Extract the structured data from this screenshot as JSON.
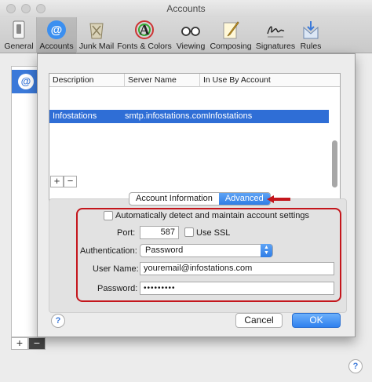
{
  "window": {
    "title": "Accounts"
  },
  "toolbar": {
    "items": [
      {
        "label": "General",
        "icon": "general-switch-icon"
      },
      {
        "label": "Accounts",
        "icon": "at-sign-icon",
        "selected": true
      },
      {
        "label": "Junk Mail",
        "icon": "junk-trash-icon"
      },
      {
        "label": "Fonts & Colors",
        "icon": "fonts-colors-icon"
      },
      {
        "label": "Viewing",
        "icon": "glasses-icon"
      },
      {
        "label": "Composing",
        "icon": "pencil-icon"
      },
      {
        "label": "Signatures",
        "icon": "signature-icon"
      },
      {
        "label": "Rules",
        "icon": "rules-icon"
      }
    ]
  },
  "sidebar": {
    "selected_icon_char": "@",
    "add_label": "+",
    "remove_label": "−"
  },
  "sheet": {
    "table": {
      "columns": [
        "Description",
        "Server Name",
        "In Use By Account"
      ],
      "rows": [
        {
          "description": "Infostations",
          "server": "smtp.infostations.com",
          "in_use_by": "Infostations"
        }
      ]
    },
    "add_label": "+",
    "remove_label": "−",
    "tabs": [
      {
        "label": "Account Information",
        "active": false
      },
      {
        "label": "Advanced",
        "active": true
      }
    ],
    "advanced": {
      "auto_detect_label": "Automatically detect and maintain account settings",
      "auto_detect_checked": false,
      "port_label": "Port:",
      "port_value": "587",
      "ssl_label": "Use SSL",
      "ssl_checked": false,
      "auth_label": "Authentication:",
      "auth_value": "Password",
      "username_label": "User Name:",
      "username_value": "youremail@infostations.com",
      "password_label": "Password:",
      "password_value": "•••••••••"
    },
    "help_label": "?",
    "cancel_label": "Cancel",
    "ok_label": "OK"
  },
  "help_label": "?",
  "colors": {
    "accent": "#2f7de6",
    "selection": "#2f6ed6",
    "highlight": "#c4161c"
  }
}
